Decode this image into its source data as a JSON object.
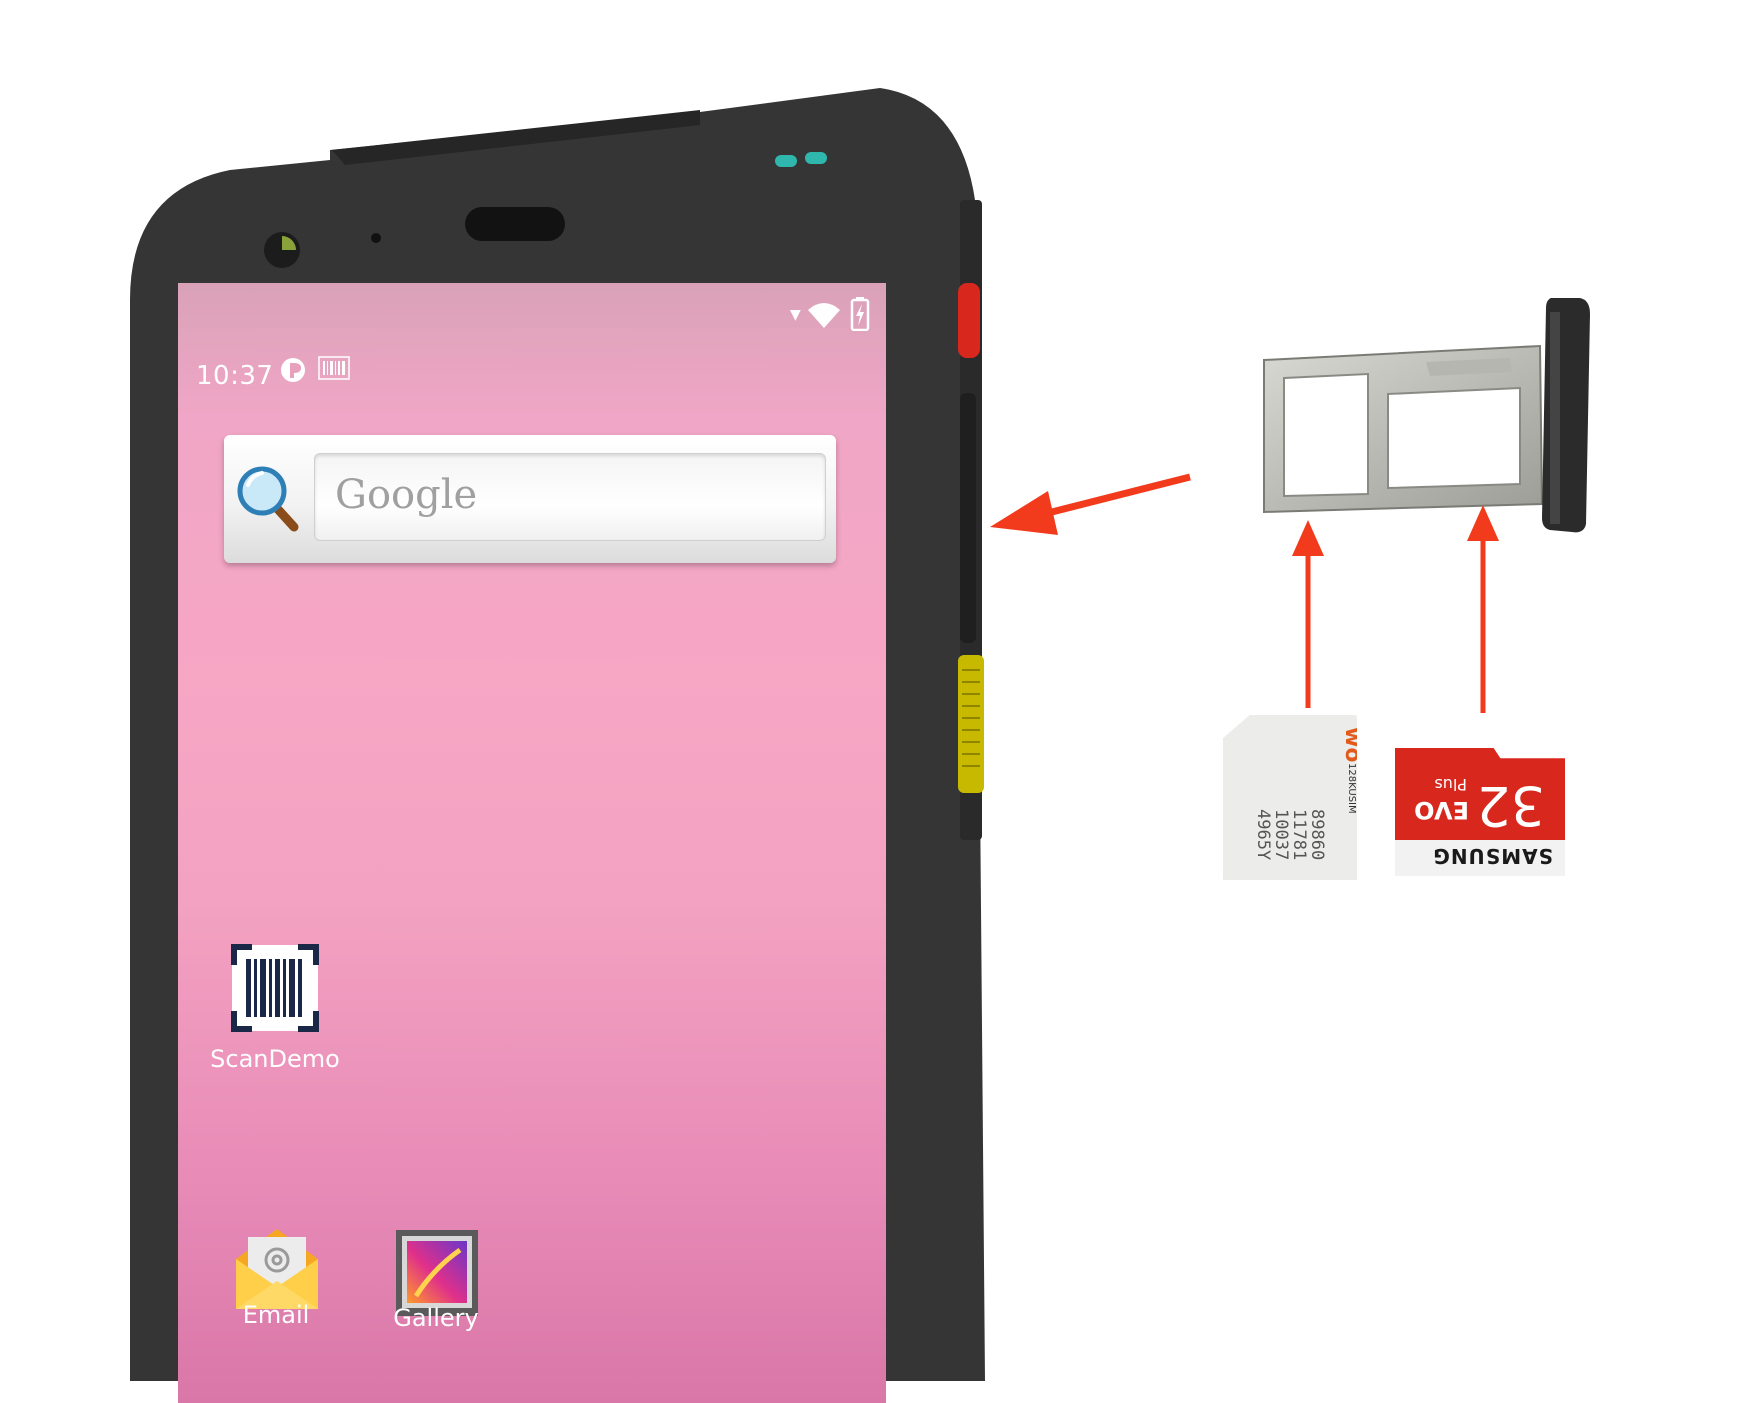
{
  "status_bar": {
    "time": "10:37"
  },
  "search_widget": {
    "placeholder": "Google"
  },
  "apps": [
    {
      "label": "ScanDemo"
    },
    {
      "label": "Email"
    },
    {
      "label": "Gallery"
    }
  ],
  "sim_card": {
    "brand_mark": "wo",
    "type": "128KUSIM",
    "digits": [
      "89860",
      "11781",
      "10037",
      "4965Y"
    ]
  },
  "sd_card": {
    "capacity": "32",
    "line1": "EVO",
    "line2": "Plus",
    "brand": "SAMSUNG"
  },
  "colors": {
    "arrow": "#f23a1d",
    "device": "#333333",
    "accent_red": "#d8281e",
    "accent_yellow": "#c7b800"
  }
}
